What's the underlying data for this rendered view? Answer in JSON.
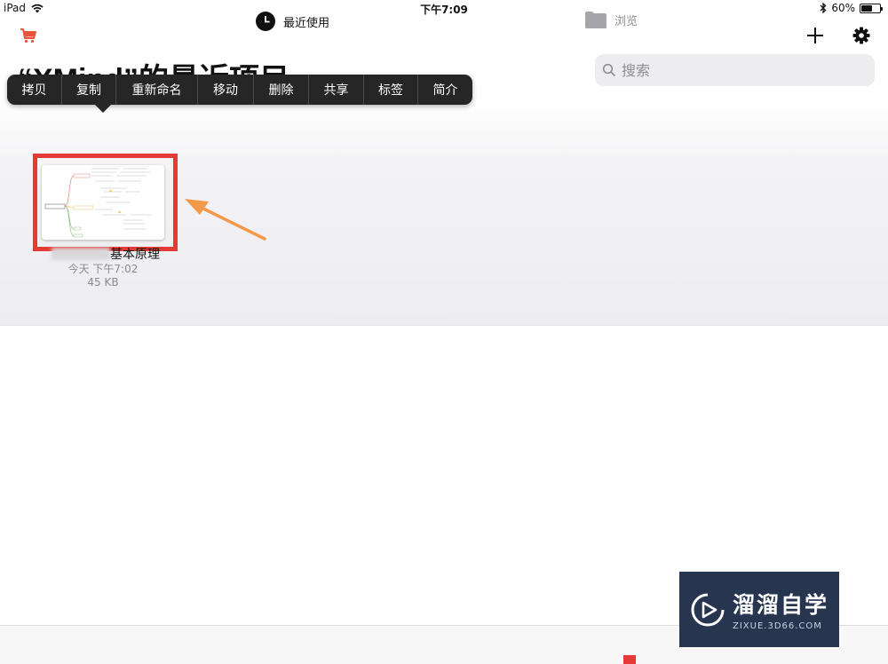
{
  "status_bar": {
    "device": "iPad",
    "time": "下午7:09",
    "battery_percent": "60%",
    "battery_level": 0.6
  },
  "header": {
    "title": "“XMind”的最近项目",
    "search_placeholder": "搜索"
  },
  "context_menu": {
    "items": [
      "拷贝",
      "复制",
      "重新命名",
      "移动",
      "删除",
      "共享",
      "标签",
      "简介"
    ]
  },
  "file": {
    "name_visible": "基本原理",
    "date": "今天 下午7:02",
    "size": "45 KB"
  },
  "tab_bar": {
    "recent_label": "最近使用",
    "browse_label": "浏览"
  },
  "watermark": {
    "title": "溜溜自学",
    "subtitle": "ZIXUE.3D66.COM"
  },
  "colors": {
    "accent_red": "#e53935",
    "arrow_orange": "#f39a4a",
    "menu_bg": "#262626"
  }
}
